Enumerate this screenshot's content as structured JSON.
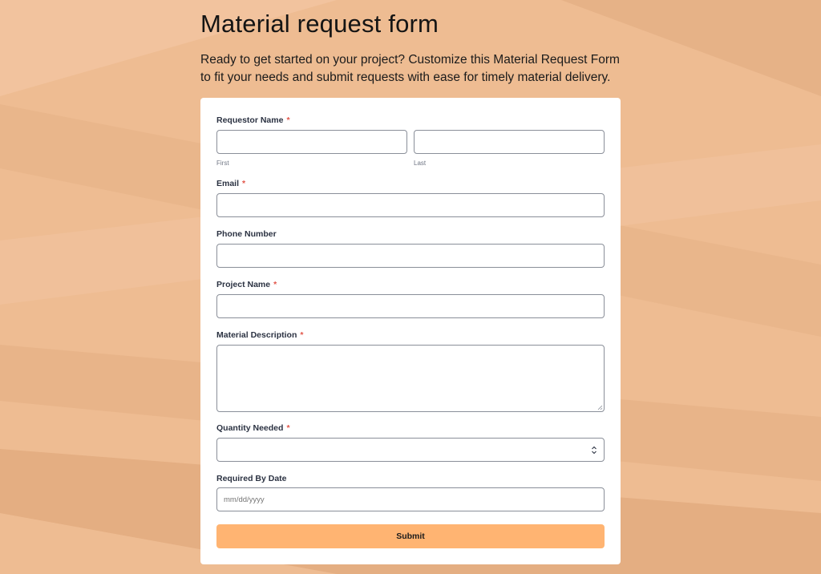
{
  "page": {
    "title": "Material request form",
    "intro": "Ready to get started on your project? Customize this Material Request Form to fit your needs and submit requests with ease for timely material delivery."
  },
  "form": {
    "requestor_name": {
      "label": "Requestor Name",
      "required_mark": "*",
      "first_value": "",
      "last_value": "",
      "first_sublabel": "First",
      "last_sublabel": "Last"
    },
    "email": {
      "label": "Email",
      "required_mark": "*",
      "value": ""
    },
    "phone": {
      "label": "Phone Number",
      "value": ""
    },
    "project_name": {
      "label": "Project Name",
      "required_mark": "*",
      "value": ""
    },
    "material_description": {
      "label": "Material Description",
      "required_mark": "*",
      "value": ""
    },
    "quantity": {
      "label": "Quantity Needed",
      "required_mark": "*",
      "value": "",
      "icon": "stepper-updown-icon"
    },
    "required_by_date": {
      "label": "Required By Date",
      "placeholder": "mm/dd/yyyy",
      "value": ""
    },
    "submit_label": "Submit"
  },
  "colors": {
    "background": "#eebc92",
    "card": "#ffffff",
    "required_mark": "#e2564a",
    "submit_button": "#ffb472",
    "field_border": "#8a8f99"
  }
}
